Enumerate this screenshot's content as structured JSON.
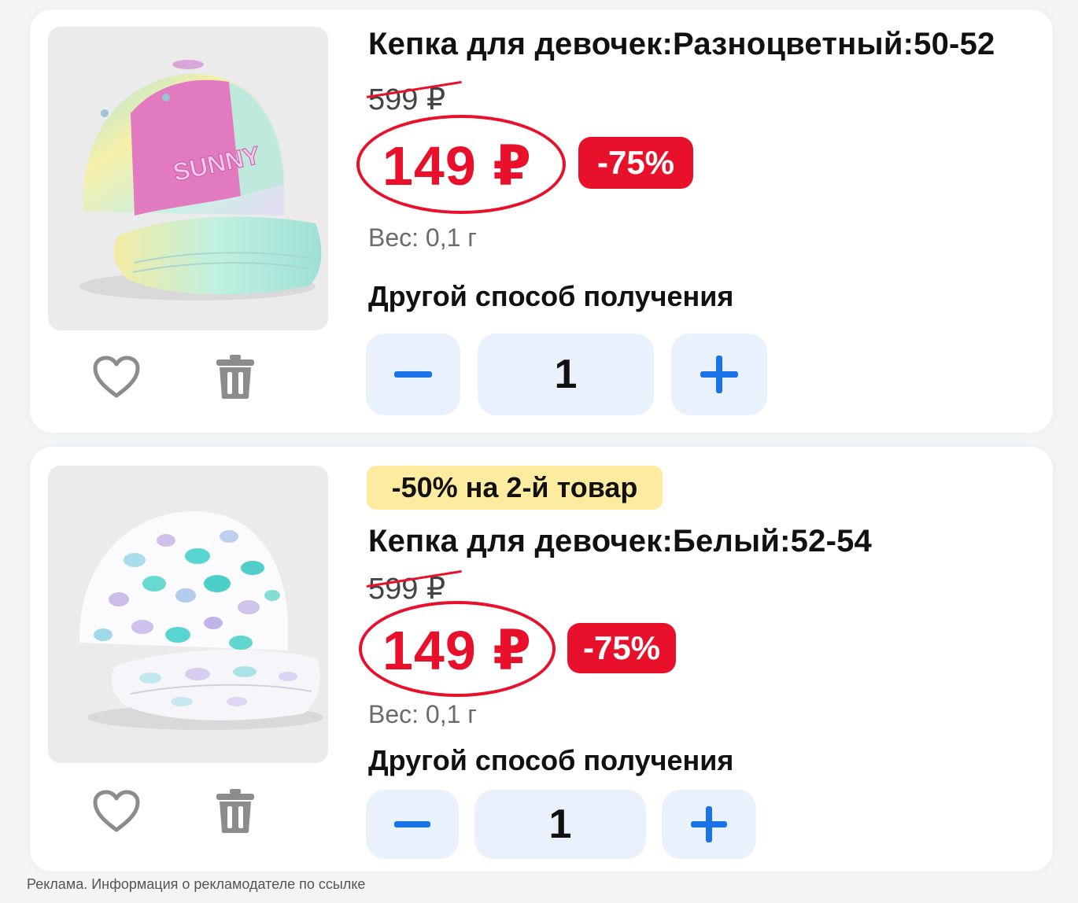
{
  "colors": {
    "accent_red": "#e8102a",
    "stepper_bg": "#e9f2fc",
    "stepper_icon": "#1a73e8",
    "promo_bg": "#fdeca0",
    "icon_gray": "#8c8c8c"
  },
  "products": [
    {
      "title": "Кепка для девочек:Разноцветный:50-52",
      "old_price": "599 ₽",
      "price": "149 ₽",
      "discount": "-75%",
      "weight": "Вес: 0,1 г",
      "delivery": "Другой способ получения",
      "quantity": "1",
      "image_label": "SUNNY",
      "icons": [
        "heart-icon",
        "trash-icon",
        "minus-icon",
        "plus-icon"
      ]
    },
    {
      "promo": "-50% на 2-й товар",
      "title": "Кепка для девочек:Белый:52-54",
      "old_price": "599 ₽",
      "price": "149 ₽",
      "discount": "-75%",
      "weight": "Вес: 0,1 г",
      "delivery": "Другой способ получения",
      "quantity": "1",
      "icons": [
        "heart-icon",
        "trash-icon",
        "minus-icon",
        "plus-icon"
      ]
    }
  ],
  "footer": {
    "ad_note": "Реклама. Информация о рекламодателе по ссылке"
  }
}
